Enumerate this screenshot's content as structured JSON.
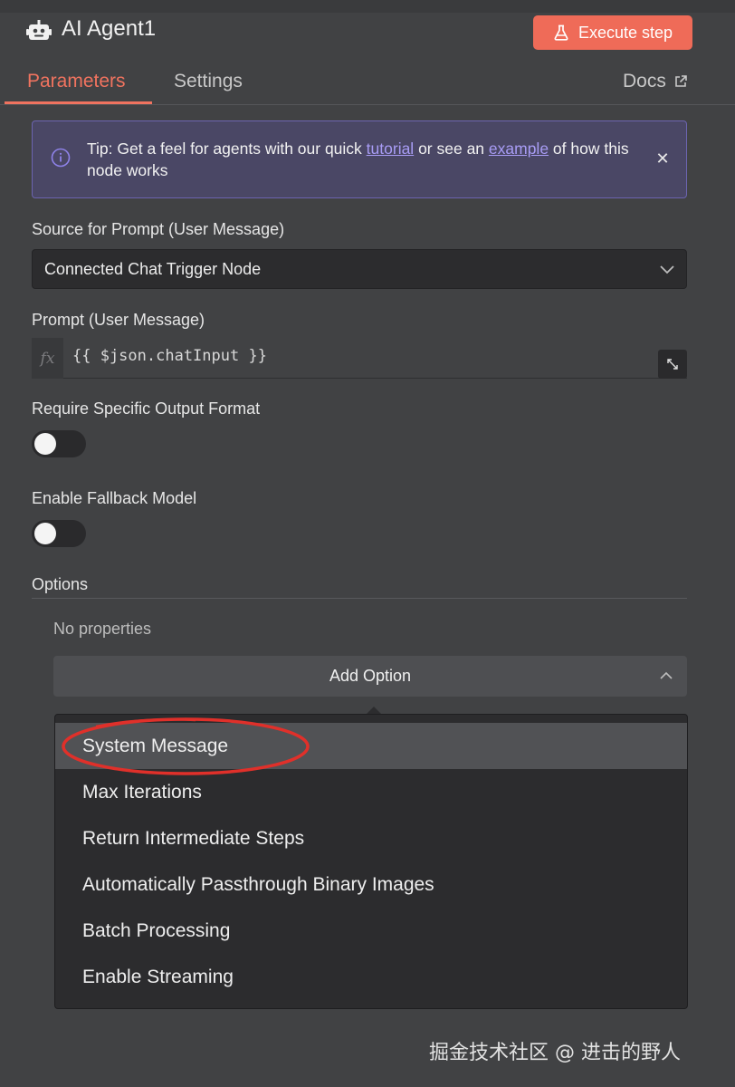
{
  "header": {
    "title": "AI Agent1",
    "execute_label": "Execute step",
    "brand_color": "#ef6b58"
  },
  "tabs": {
    "parameters": "Parameters",
    "settings": "Settings",
    "docs": "Docs",
    "active": "Parameters"
  },
  "tip": {
    "prefix": "Tip: Get a feel for agents with our quick ",
    "link1": "tutorial",
    "middle": " or see an ",
    "link2": "example",
    "suffix": " of how this node works"
  },
  "fields": {
    "source_label": "Source for Prompt (User Message)",
    "source_value": "Connected Chat Trigger Node",
    "prompt_label": "Prompt (User Message)",
    "prompt_fx": "fx",
    "prompt_value": "{{ $json.chatInput }}",
    "output_format_label": "Require Specific Output Format",
    "output_format_on": false,
    "fallback_label": "Enable Fallback Model",
    "fallback_on": false
  },
  "options": {
    "label": "Options",
    "empty_text": "No properties",
    "add_label": "Add Option",
    "menu": [
      "System Message",
      "Max Iterations",
      "Return Intermediate Steps",
      "Automatically Passthrough Binary Images",
      "Batch Processing",
      "Enable Streaming"
    ],
    "highlighted": "System Message"
  },
  "watermark": "掘金技术社区 @ 进击的野人"
}
